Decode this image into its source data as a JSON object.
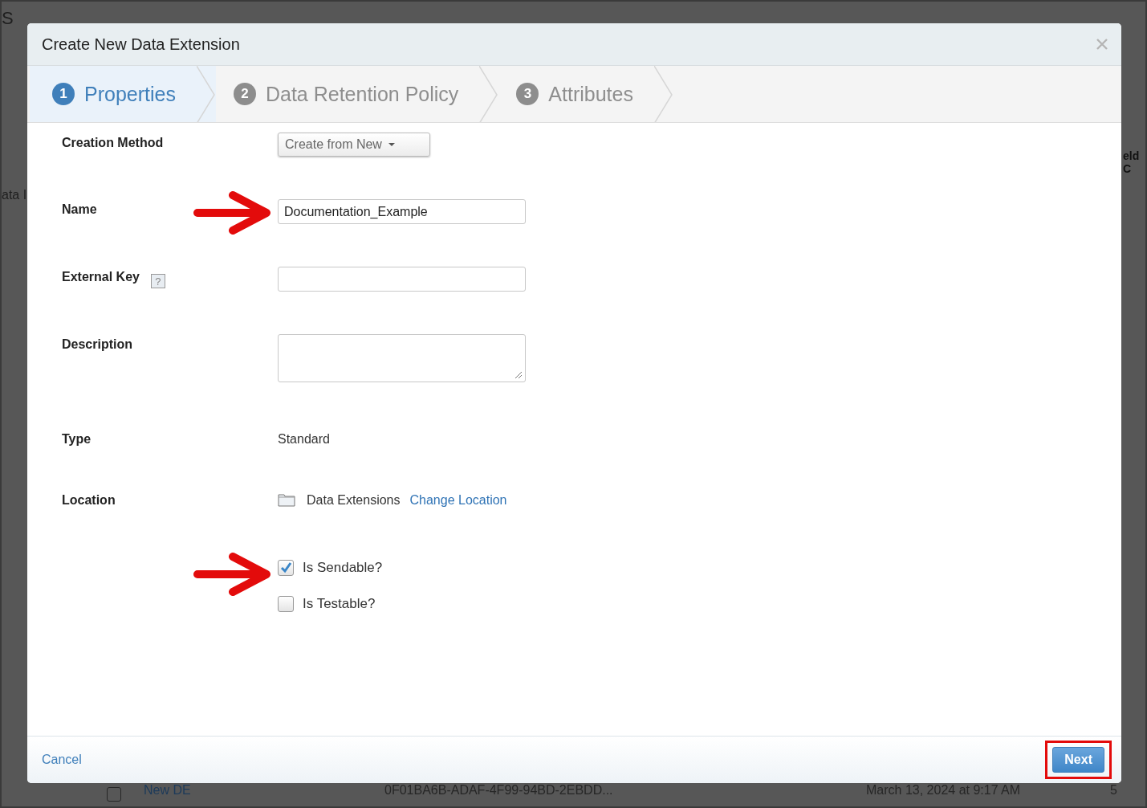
{
  "background": {
    "heading_fragment": "S",
    "sidebar_fragment": "ata I",
    "column_fragment": "eld C",
    "row": {
      "checked": false,
      "name": "New DE",
      "key": "0F01BA6B-ADAF-4F99-94BD-2EBDD...",
      "date": "March 13, 2024 at 9:17 AM",
      "count": "5"
    }
  },
  "dialog": {
    "title": "Create New Data Extension",
    "steps": [
      {
        "number": "1",
        "label": "Properties",
        "selected": true
      },
      {
        "number": "2",
        "label": "Data Retention Policy",
        "selected": false
      },
      {
        "number": "3",
        "label": "Attributes",
        "selected": false
      }
    ],
    "fields": [
      {
        "kind": "dropdown",
        "label": "Creation Method",
        "value": "Create from New",
        "arrow": false
      },
      {
        "kind": "text",
        "label": "Name",
        "value": "Documentation_Example",
        "arrow": true
      },
      {
        "kind": "text",
        "label": "External Key",
        "help": "?",
        "arrow": false
      },
      {
        "kind": "textarea",
        "label": "Description",
        "arrow": false
      },
      {
        "kind": "static",
        "label": "Type",
        "value": "Standard",
        "arrow": false
      },
      {
        "kind": "location",
        "label": "Location",
        "value": "Data Extensions",
        "link": "Change Location",
        "arrow": false
      },
      {
        "kind": "checkbox",
        "value": "Is Sendable?",
        "checked": true,
        "arrow": true
      },
      {
        "kind": "checkbox",
        "value": "Is Testable?",
        "checked": false,
        "arrow": false
      }
    ],
    "footer": {
      "cancel": "Cancel",
      "next": "Next",
      "next_highlighted": true
    }
  }
}
